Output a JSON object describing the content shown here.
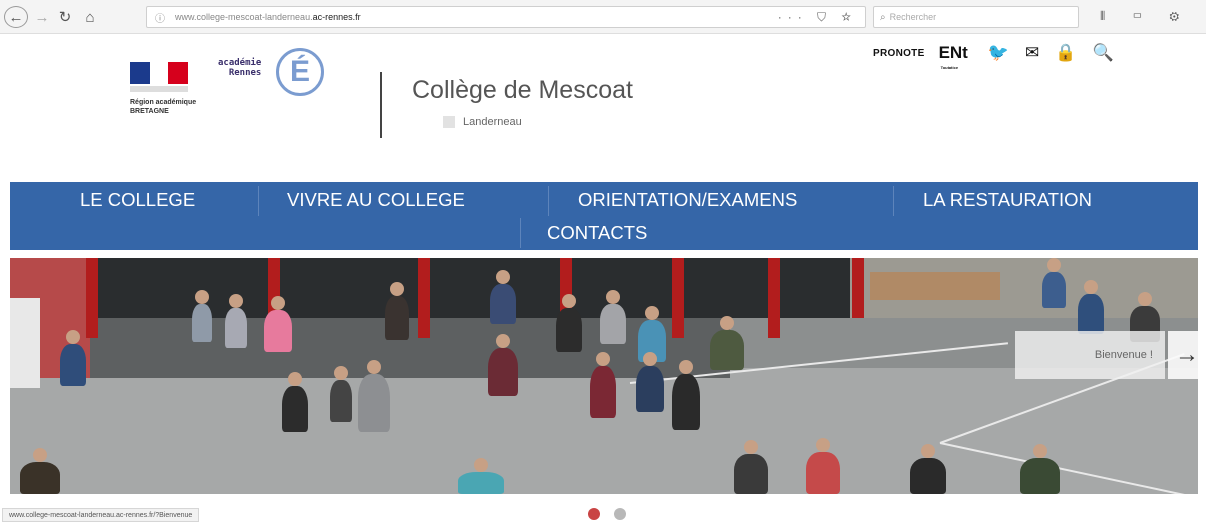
{
  "browser": {
    "url_prefix": "www.college-mescoat-landerneau.",
    "url_host": "ac-rennes.fr",
    "url_actions": "··· ⛉ ☆",
    "search_placeholder": "Rechercher",
    "back_glyph": "←",
    "forward_glyph": "→",
    "reload_glyph": "↻",
    "home_glyph": "⌂",
    "info_glyph": "ⓘ",
    "toolbar_icons": "⦀ ▭ ⚙",
    "status_url": "www.college-mescoat-landerneau.ac-rennes.fr/?Bienvenue"
  },
  "header": {
    "academie_line1": "académie",
    "academie_line2": "Rennes",
    "academie_letter": "É",
    "region_line1": "Région académique",
    "region_line2": "BRETAGNE",
    "site_title": "Collège de Mescoat",
    "site_subtitle": "Landerneau"
  },
  "tools": {
    "pronote": "PRONOTE",
    "ent": "ENt",
    "ent_sub": "Toutatice",
    "twitter_glyph": "🐦",
    "mail_glyph": "✉",
    "lock_glyph": "🔒",
    "search_glyph": "🔍"
  },
  "menu": {
    "items": [
      "LE COLLEGE",
      "VIVRE AU COLLEGE",
      "ORIENTATION/EXAMENS",
      "LA RESTAURATION",
      "CONTACTS"
    ]
  },
  "slider": {
    "caption": "Bienvenue !",
    "next_glyph": "→"
  },
  "colors": {
    "menu_bg": "#3566a8",
    "dot_active": "#c94444",
    "dot_inactive": "#b8b8b8"
  }
}
